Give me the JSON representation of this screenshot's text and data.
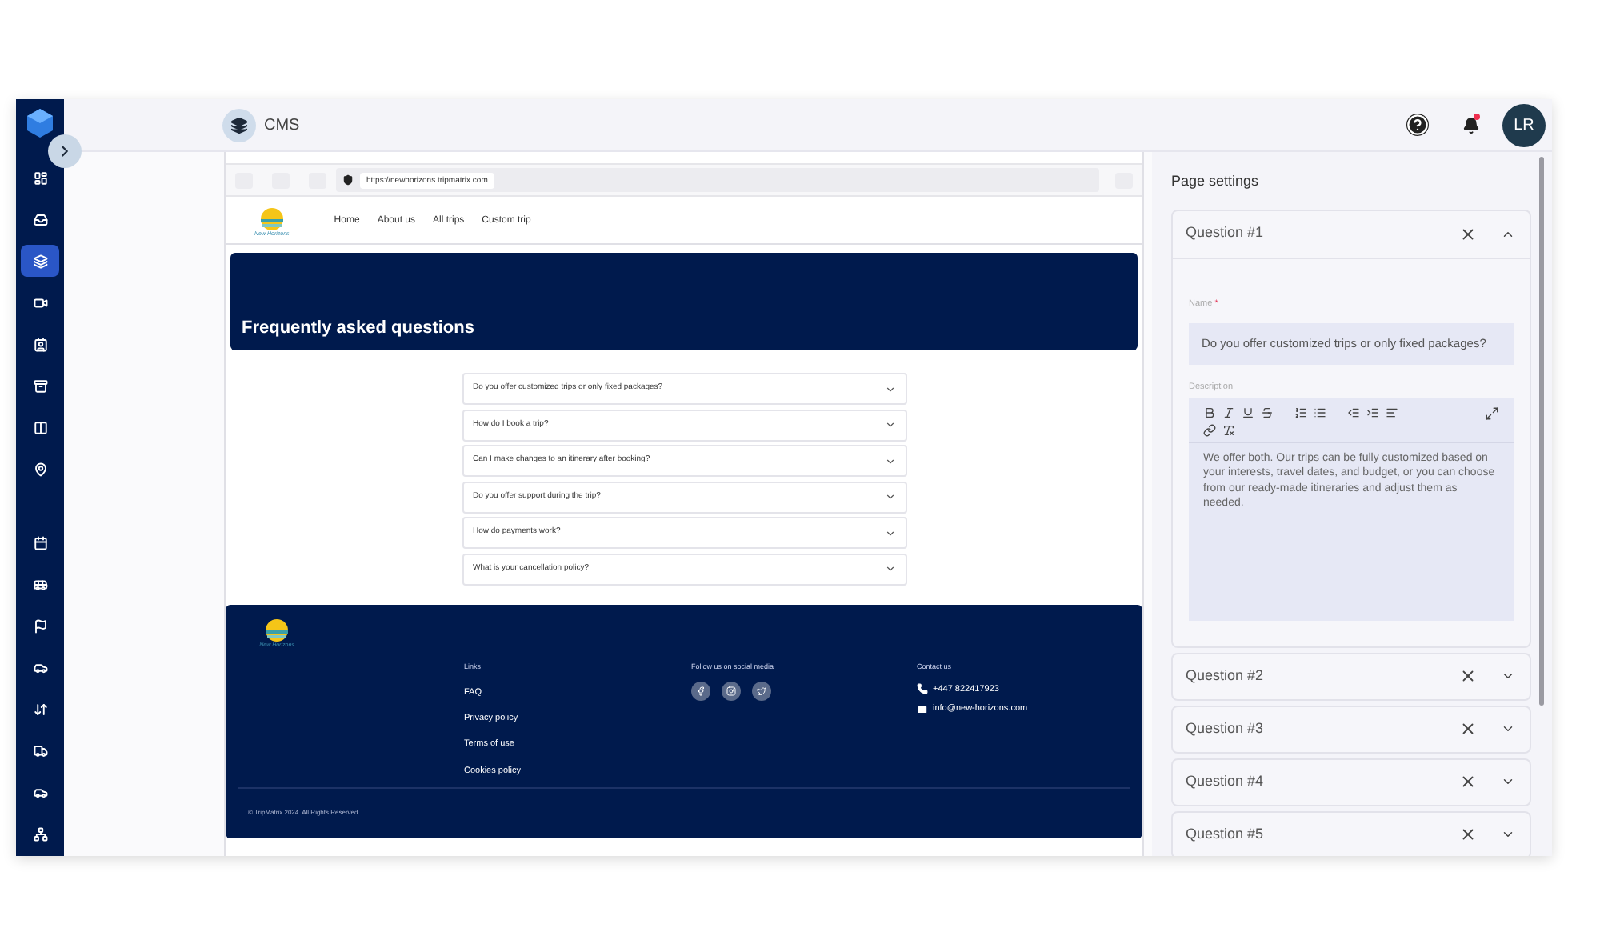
{
  "sidebar": {
    "groups": [
      [
        {
          "selected": false
        },
        {
          "selected": false
        },
        {
          "selected": true
        },
        {
          "selected": false
        },
        {
          "selected": false
        },
        {
          "selected": false
        },
        {
          "selected": false
        },
        {
          "selected": false
        }
      ],
      [
        {
          "selected": false
        },
        {
          "selected": false
        },
        {
          "selected": false
        },
        {
          "selected": false
        },
        {
          "selected": false
        },
        {
          "selected": false
        },
        {
          "selected": false
        },
        {
          "selected": false
        }
      ]
    ]
  },
  "header": {
    "title": "CMS",
    "avatar": "LR",
    "notification": true
  },
  "preview": {
    "url": "https://newhorizons.tripmatrix.com",
    "logo_text": "New Horizons",
    "nav": [
      "Home",
      "About us",
      "All trips",
      "Custom trip"
    ],
    "hero_title": "Frequently asked questions",
    "faq": [
      {
        "question": "Do you offer customized trips or only fixed packages?",
        "expanded": false
      },
      {
        "question": "How do I book a trip?",
        "expanded": false
      },
      {
        "question": "Can I make changes to an itinerary after booking?",
        "expanded": false
      },
      {
        "question": "Do you offer support during the trip?",
        "expanded": false
      },
      {
        "question": "How do payments work?",
        "expanded": false
      },
      {
        "question": "What is your cancellation policy?",
        "expanded": false
      }
    ],
    "footer": {
      "logo_text": "New Horizons",
      "links_title": "Links",
      "links": [
        "FAQ",
        "Privacy policy",
        "Terms of use",
        "Cookies policy"
      ],
      "social_title": "Follow us on social media",
      "contact_title": "Contact us",
      "phone": "+447 822417923",
      "email": "info@new-horizons.com",
      "copyright": "© TripMatrix 2024. All Rights Reserved"
    }
  },
  "settings": {
    "title": "Page settings",
    "questions": [
      {
        "title": "Question #1",
        "expanded": true,
        "name_label": "Name",
        "required_mark": "*",
        "name": "Do you offer customized trips or only fixed packages?",
        "description_label": "Description",
        "description": "We offer both. Our trips can be fully customized based on your interests, travel dates, and budget, or you can choose from our ready-made itineraries and adjust them as needed."
      },
      {
        "title": "Question #2",
        "expanded": false
      },
      {
        "title": "Question #3",
        "expanded": false
      },
      {
        "title": "Question #4",
        "expanded": false
      },
      {
        "title": "Question #5",
        "expanded": false
      }
    ]
  }
}
